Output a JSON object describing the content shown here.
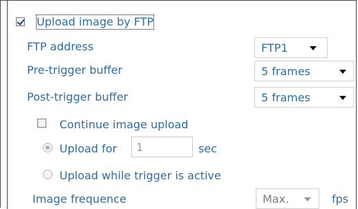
{
  "ftp": {
    "enable_label": "Upload image by FTP",
    "enabled": true,
    "address_label": "FTP address",
    "address_value": "FTP1",
    "pre_label": "Pre-trigger buffer",
    "pre_value": "5 frames",
    "post_label": "Post-trigger buffer",
    "post_value": "5 frames",
    "continue_label": "Continue image upload",
    "continue_checked": false,
    "upload_for_label": "Upload for",
    "upload_for_value": "1",
    "sec_label": "sec",
    "while_active_label": "Upload while trigger is active",
    "frequence_label": "Image frequence",
    "frequence_value": "Max.",
    "fps_label": "fps"
  },
  "icons": {
    "checkbox": "checkbox-icon",
    "radio": "radio-icon",
    "dropdown": "dropdown-arrow-icon"
  },
  "colors": {
    "text": "#2e6ea4",
    "disabled_text": "#7b7b7b"
  }
}
